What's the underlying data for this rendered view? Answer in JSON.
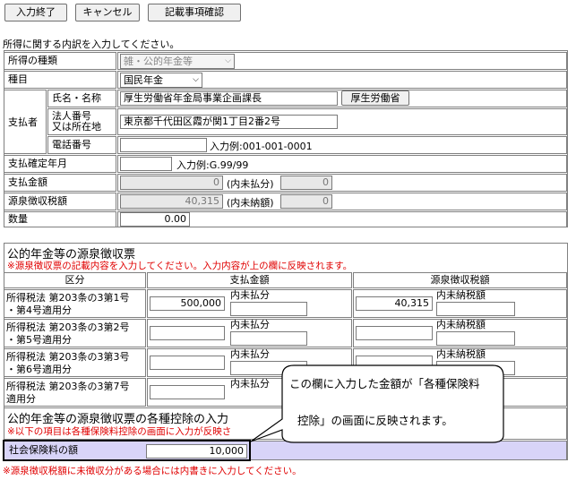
{
  "toolbar": {
    "finish_label": "入力終了",
    "cancel_label": "キャンセル",
    "confirm_label": "記載事項確認"
  },
  "intro_text": "所得に関する内訳を入力してください。",
  "form": {
    "income_type_label": "所得の種類",
    "income_type_value": "雑・公的年金等",
    "category_label": "種目",
    "category_value": "国民年金",
    "payer_label": "支払者",
    "name_label": "氏名・名称",
    "name_value": "厚生労働省年金局事業企画課長",
    "name_button": "厚生労働省",
    "corp_label_1": "法人番号",
    "corp_label_2": "又は所在地",
    "address_value": "東京都千代田区霞が関1丁目2番2号",
    "phone_label": "電話番号",
    "phone_value": "",
    "phone_example": "入力例:001-001-0001",
    "pay_date_label": "支払確定年月",
    "pay_date_value": "",
    "pay_date_example": "入力例:G.99/99",
    "amount_label": "支払金額",
    "amount_value": "0",
    "amount_unpaid_label": "(内未払分)",
    "amount_unpaid_value": "0",
    "withholding_label": "源泉徴収税額",
    "withholding_value": "40,315",
    "withholding_unpaid_label": "(内未納額)",
    "withholding_unpaid_value": "0",
    "qty_label": "数量",
    "qty_value": "0.00"
  },
  "slip": {
    "title": "公的年金等の源泉徴収票",
    "note": "※源泉徴収票の記載内容を入力してください。入力内容が上の欄に反映されます。",
    "col_category": "区分",
    "col_amount": "支払金額",
    "col_withholding": "源泉徴収税額",
    "rows": [
      {
        "label_1": "所得税法 第203条の3第1号",
        "label_2": "・第4号適用分",
        "amount": "500,000",
        "unpaid_label": "内未払分",
        "withholding": "40,315",
        "unpaid2_label": "内未納税額"
      },
      {
        "label_1": "所得税法 第203条の3第2号",
        "label_2": "・第5号適用分",
        "amount": "",
        "unpaid_label": "内未払分",
        "withholding": "",
        "unpaid2_label": "内未納税額"
      },
      {
        "label_1": "所得税法 第203条の3第3号",
        "label_2": "・第6号適用分",
        "amount": "",
        "unpaid_label": "内未払分",
        "withholding": "",
        "unpaid2_label": "内未納税額"
      },
      {
        "label_1": "所得税法 第203条の3第7号",
        "label_2": "適用分",
        "amount": "",
        "unpaid_label": "内未払分",
        "withholding": "",
        "unpaid2_label": ""
      }
    ]
  },
  "deduction": {
    "title": "公的年金等の源泉徴収票の各種控除の入力",
    "note": "※以下の項目は各種保険料控除の画面に入力が反映さ",
    "social_label": "社会保険料の額",
    "social_value": "10,000"
  },
  "bottom_note": "※源泉徴収税額に未徴収分がある場合には内書きに入力してください。",
  "callout": {
    "line1": "この欄に入力した金額が「各種保険料",
    "line2": "控除」の画面に反映されます。"
  },
  "colors": {
    "red_note": "#e00000",
    "highlight_row": "#d8d4f8"
  }
}
